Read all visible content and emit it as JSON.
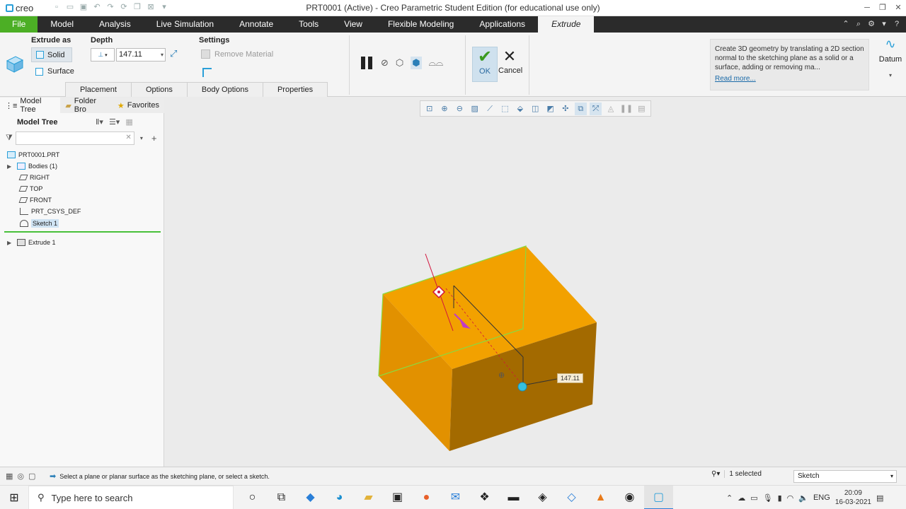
{
  "app": {
    "logo_text": "creo",
    "window_title": "PRT0001 (Active) - Creo Parametric Student Edition (for educational use only)"
  },
  "ribbon_tabs": {
    "file": "File",
    "model": "Model",
    "analysis": "Analysis",
    "live_simulation": "Live Simulation",
    "annotate": "Annotate",
    "tools": "Tools",
    "view": "View",
    "flexible_modeling": "Flexible Modeling",
    "applications": "Applications",
    "extrude": "Extrude"
  },
  "extrude_panel": {
    "extrude_as_label": "Extrude as",
    "solid_label": "Solid",
    "surface_label": "Surface",
    "depth_label": "Depth",
    "depth_value": "147.11",
    "settings_label": "Settings",
    "remove_material_label": "Remove Material",
    "sub_tabs": [
      "Placement",
      "Options",
      "Body Options",
      "Properties"
    ],
    "ok_label": "OK",
    "cancel_label": "Cancel",
    "help_text": "Create 3D geometry by translating a 2D section normal to the sketching plane as a solid or a surface, adding or removing ma...",
    "read_more": "Read more...",
    "datum_label": "Datum"
  },
  "left_panel": {
    "tabs": [
      "Model Tree",
      "Folder Bro",
      "Favorites"
    ],
    "header": "Model Tree",
    "tree": {
      "root": "PRT0001.PRT",
      "bodies": "Bodies (1)",
      "right": "RIGHT",
      "top": "TOP",
      "front": "FRONT",
      "csys": "PRT_CSYS_DEF",
      "sketch": "Sketch 1",
      "extrude": "Extrude 1"
    }
  },
  "graphics": {
    "dimension_label": "147.11",
    "colors": {
      "top_face": "#F2A100",
      "right_face": "#A36A00",
      "front_face": "#E29100",
      "edge_highlight": "#8CD93E"
    }
  },
  "status_bar": {
    "message": "Select a plane or planar surface as the sketching plane, or select a sketch.",
    "selected": "1 selected",
    "filter_value": "Sketch"
  },
  "taskbar": {
    "search_placeholder": "Type here to search",
    "language": "ENG",
    "time": "20:09",
    "date": "16-03-2021"
  }
}
